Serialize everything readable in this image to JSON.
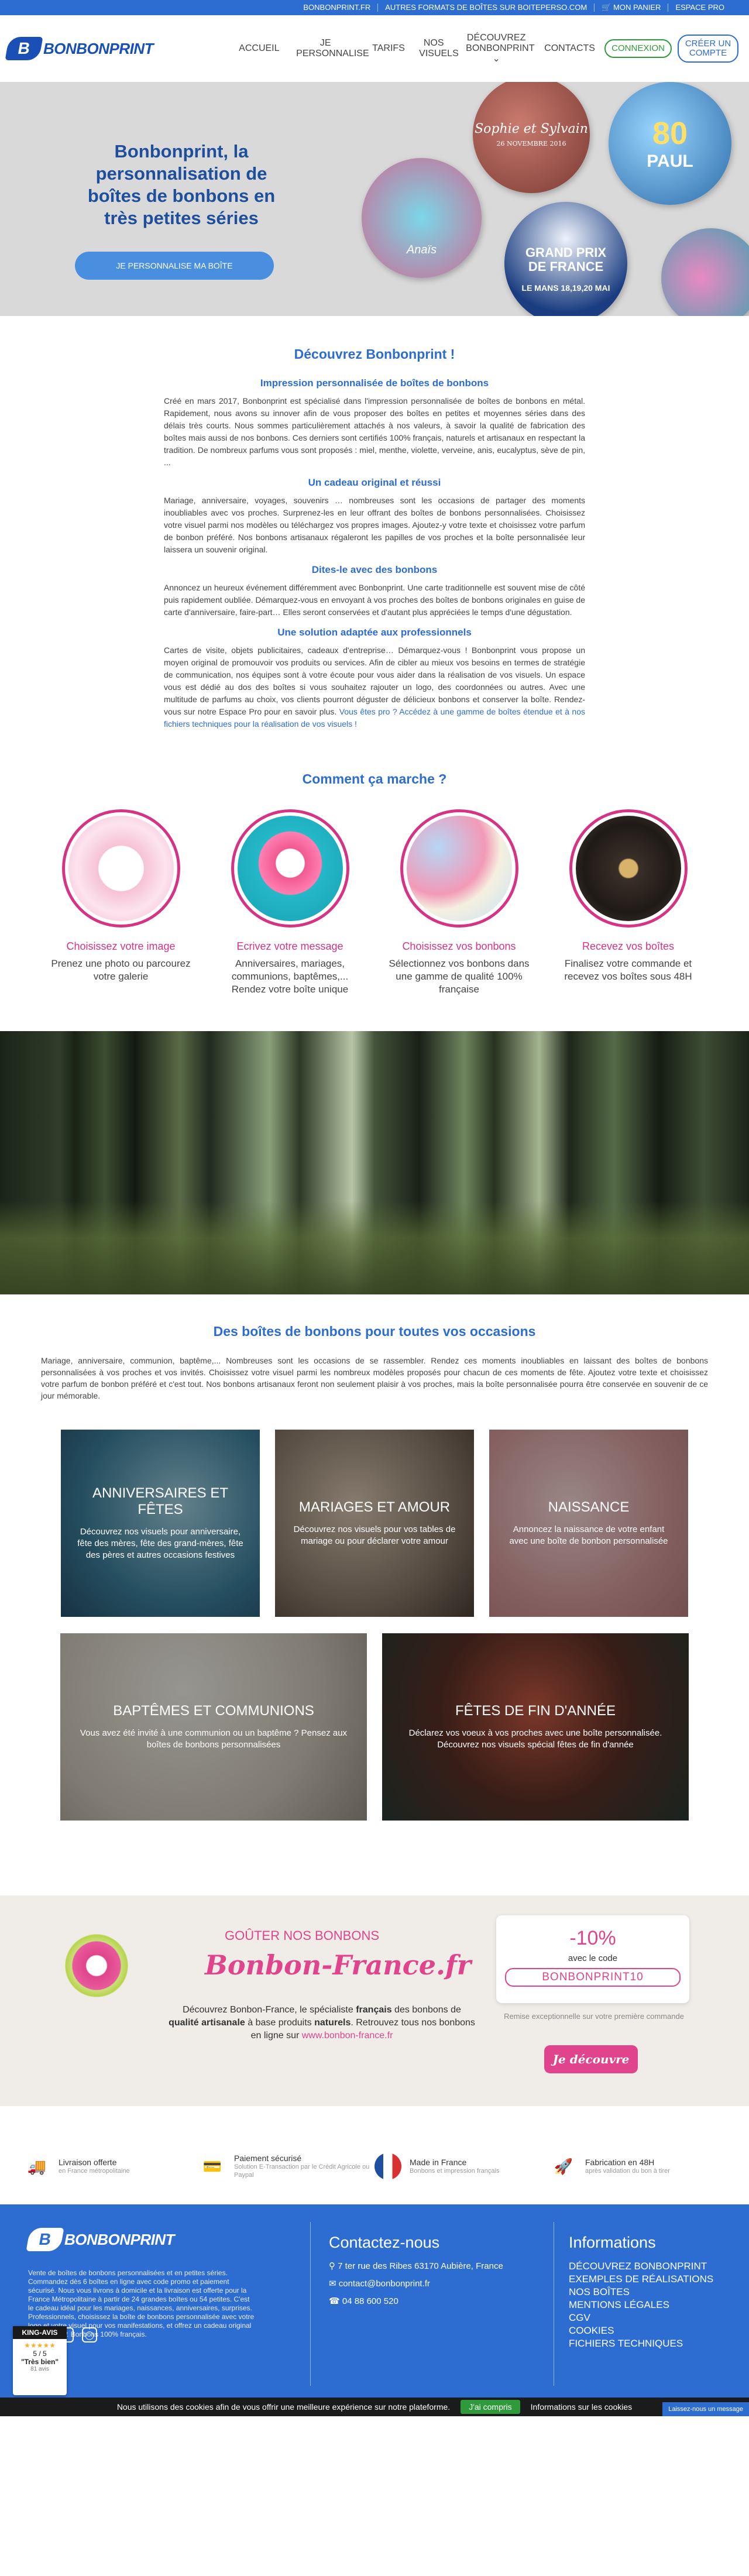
{
  "topbar": {
    "items": [
      "BONBONPRINT.FR",
      "AUTRES FORMATS DE BOÎTES SUR BOITEPERSO.COM",
      "MON PANIER",
      "ESPACE PRO"
    ]
  },
  "header": {
    "logo_bold": "BONBON",
    "logo_light": "PRINT",
    "logo_mark": "B",
    "nav": [
      "ACCUEIL",
      "JE PERSONNALISE",
      "TARIFS",
      "NOS VISUELS",
      "DÉCOUVREZ BONBONPRINT",
      "CONTACTS"
    ],
    "connexion": "CONNEXION",
    "create_account": "CRÉER UN COMPTE"
  },
  "hero": {
    "title": "Bonbonprint, la personnalisation de boîtes de bonbons en très petites séries",
    "button": "JE PERSONNALISE MA BOÎTE",
    "disc_wood_names": "Sophie et Sylvain",
    "disc_wood_date": "26 NOVEMBRE 2016",
    "disc_paul_age": "80",
    "disc_paul_name": "PAUL",
    "disc_pool_text": "Anaïs",
    "disc_gp_title": "GRAND PRIX DE FRANCE",
    "disc_gp_sub": "LE MANS 18,19,20 MAI"
  },
  "discover": {
    "title": "Découvrez Bonbonprint !",
    "blocks": [
      {
        "heading": "Impression personnalisée de boîtes de bonbons",
        "text": "Créé en mars 2017, Bonbonprint est spécialisé dans l'impression personnalisée de boîtes de bonbons en métal. Rapidement, nous avons su innover afin de vous proposer des boîtes en petites et moyennes séries dans des délais très courts. Nous sommes particulièrement attachés à nos valeurs, à savoir la qualité de fabrication des boîtes mais aussi de nos bonbons. Ces derniers sont certifiés 100% français, naturels et artisanaux en respectant la tradition. De nombreux parfums vous sont proposés : miel, menthe, violette, verveine, anis, eucalyptus, sève de pin, ..."
      },
      {
        "heading": "Un cadeau original et réussi",
        "text": "Mariage, anniversaire, voyages, souvenirs … nombreuses sont les occasions de partager des moments inoubliables avec vos proches. Surprenez-les en leur offrant des boîtes de bonbons personnalisées. Choisissez votre visuel parmi nos modèles ou téléchargez vos propres images. Ajoutez-y votre texte et choisissez votre parfum de bonbon préféré. Nos bonbons artisanaux régaleront les papilles de vos proches et la boîte personnalisée leur laissera un souvenir original."
      },
      {
        "heading": "Dites-le avec des bonbons",
        "text": "Annoncez un heureux événement différemment avec Bonbonprint. Une carte traditionnelle est souvent mise de côté puis rapidement oubliée. Démarquez-vous en envoyant à vos proches des boîtes de bonbons originales en guise de carte d'anniversaire, faire-part… Elles seront conservées et d'autant plus appréciées le temps d'une dégustation."
      },
      {
        "heading": "Une solution adaptée aux professionnels",
        "text": "Cartes de visite, objets publicitaires, cadeaux d'entreprise… Démarquez-vous ! Bonbonprint vous propose un moyen original de promouvoir vos produits ou services. Afin de cibler au mieux vos besoins en termes de stratégie de communication, nos équipes sont à votre écoute pour vous aider dans la réalisation de vos visuels. Un espace vous est dédié au dos des boîtes si vous souhaitez rajouter un logo, des coordonnées ou autres. Avec une multitude de parfums au choix, vos clients pourront déguster de délicieux bonbons et conserver la boîte. Rendez-vous sur notre Espace Pro pour en savoir plus.",
        "link": "Vous êtes pro ? Accédez à une gamme de boîtes étendue et à nos fichiers techniques pour la réalisation de vos visuels !"
      }
    ]
  },
  "how": {
    "title": "Comment ça marche ?",
    "steps": [
      {
        "title": "Choisissez votre image",
        "text": "Prenez une photo ou parcourez votre galerie"
      },
      {
        "title": "Ecrivez votre message",
        "text": "Anniversaires, mariages, communions, baptêmes,... Rendez votre boîte unique"
      },
      {
        "title": "Choisissez vos bonbons",
        "text": "Sélectionnez vos bonbons dans une gamme de qualité 100% française"
      },
      {
        "title": "Recevez vos boîtes",
        "text": "Finalisez votre commande et recevez vos boîtes sous 48H"
      }
    ]
  },
  "occasions": {
    "title": "Des boîtes de bonbons pour toutes vos occasions",
    "text": "Mariage, anniversaire, communion, baptême,... Nombreuses sont les occasions de se rassembler. Rendez ces moments inoubliables en laissant des boîtes de bonbons personnalisées à vos proches et vos invités. Choisissez votre visuel parmi les nombreux modèles proposés pour chacun de ces moments de fête. Ajoutez votre texte et choisissez votre parfum de bonbon préféré et c'est tout. Nos bonbons artisanaux feront non seulement plaisir à vos proches, mais la boîte personnalisée pourra être conservée en souvenir de ce jour mémorable.",
    "tiles": [
      {
        "title": "ANNIVERSAIRES ET FÊTES",
        "text": "Découvrez nos visuels pour anniversaire, fête des mères, fête des grand-mères, fête des pères et autres occasions festives"
      },
      {
        "title": "MARIAGES ET AMOUR",
        "text": "Découvrez nos visuels pour vos tables de mariage ou pour déclarer votre amour"
      },
      {
        "title": "NAISSANCE",
        "text": "Annoncez la naissance de votre enfant avec une boîte de bonbon personnalisée"
      },
      {
        "title": "BAPTÊMES ET COMMUNIONS",
        "text": "Vous avez été invité à une communion ou un baptême ? Pensez aux boîtes de bonbons personnalisées"
      },
      {
        "title": "FÊTES DE FIN D'ANNÉE",
        "text": "Déclarez vos voeux à vos proches avec une boîte personnalisée. Découvrez nos visuels spécial fêtes de fin d'année"
      }
    ]
  },
  "promo": {
    "title": "GOÛTER NOS BONBONS",
    "brand": "Bonbon-France.fr",
    "text_1": "Découvrez Bonbon-France, le spécialiste ",
    "text_bold_1": "français",
    "text_2": " des bonbons de ",
    "text_bold_2": "qualité artisanale",
    "text_3": " à base produits ",
    "text_bold_3": "naturels",
    "text_4": ". Retrouvez tous nos bonbons en ligne sur ",
    "link": "www.bonbon-france.fr",
    "percent": "-10%",
    "code_label": "avec le code",
    "code": "BONBONPRINT10",
    "note": "Remise exceptionnelle sur votre première commande",
    "button": "Je découvre"
  },
  "features": [
    {
      "title": "Livraison offerte",
      "sub": "en France métropolitaine"
    },
    {
      "title": "Paiement sécurisé",
      "sub": "Solution E-Transaction par le Crédit Agricole ou Paypal"
    },
    {
      "title": "Made in France",
      "sub": "Bonbons et impression français"
    },
    {
      "title": "Fabrication en 48H",
      "sub": "après validation du bon à tirer"
    }
  ],
  "footer": {
    "about": "Vente de boîtes de bonbons personnalisées et en petites séries. Commandez dès 6 boîtes en ligne avec code promo et paiement sécurisé. Nous vous livrons à domicile et la livraison est offerte pour la France Métropolitaine à partir de 24 grandes boîtes ou 54 petites. C'est le cadeau idéal pour les mariages, naissances, anniversaires, surprises. Professionnels, choisissez la boîte de bonbons personnalisée avec votre logo et votre visuel pour vos manifestations, et offrez un cadeau original à vos clients. Bonbons 100% français.",
    "contact_title": "Contactez-nous",
    "address": "7 ter rue des Ribes 63170 Aubière, France",
    "email": "contact@bonbonprint.fr",
    "phone": "04 88 600 520",
    "info_title": "Informations",
    "links": [
      "DÉCOUVREZ BONBONPRINT",
      "EXEMPLES DE RÉALISATIONS",
      "NOS BOÎTES",
      "MENTIONS LÉGALES",
      "CGV",
      "COOKIES",
      "FICHIERS TECHNIQUES"
    ],
    "king_title": "KING-AVIS",
    "king_score": "5 / 5",
    "king_label": "\"Très bien\"",
    "king_count": "81 avis"
  },
  "cookie": {
    "text": "Nous utilisons des cookies afin de vous offrir une meilleure expérience sur notre plateforme.",
    "accept": "J'ai compris",
    "more": "Informations sur les cookies",
    "message": "Laissez-nous un message"
  },
  "colors": {
    "primary_blue": "#2d6cd1",
    "pink": "#d63384",
    "green": "#2e9a3a"
  }
}
